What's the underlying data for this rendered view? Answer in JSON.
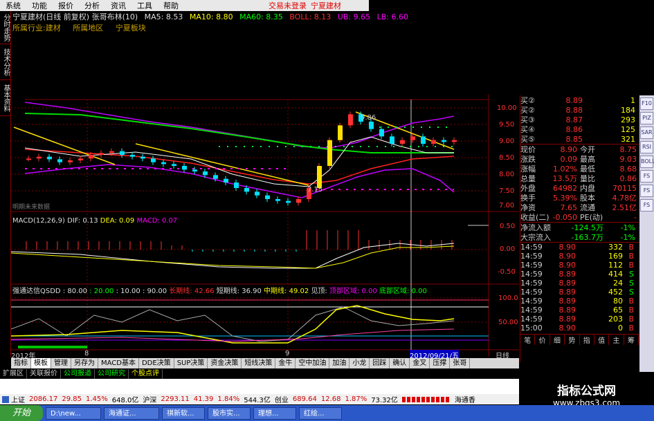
{
  "menu": {
    "items": [
      "系统",
      "功能",
      "报价",
      "分析",
      "资讯",
      "工具",
      "帮助"
    ],
    "status": "交易未登录",
    "stock_name": "宁夏建材"
  },
  "left_tabs": [
    "分时走势",
    "技术分析",
    "基本资料"
  ],
  "chart_header": {
    "title": "宁夏建材(日线 前复权) 张哥布林(10)",
    "ma5": "MA5: 8.53",
    "ma10": "MA10: 8.80",
    "ma60": "MA60: 8.35",
    "boll": "BOLL: 8.13",
    "ub": "UB: 9.65",
    "lb": "LB: 6.60",
    "industry": "所属行业:建材",
    "region": "所属地区",
    "board": "宁夏板块"
  },
  "price_axis": [
    "10.00",
    "9.50",
    "9.00",
    "8.50",
    "8.00",
    "7.50",
    "7.00"
  ],
  "chart_labels": {
    "peak": "9.86",
    "low": "7.15",
    "note": "明期未来数据"
  },
  "macd": {
    "label": "MACD(12,26,9)",
    "dif": "DIF: 0.13",
    "dea": "DEA: 0.09",
    "macd": "MACD: 0.07",
    "axis": [
      "0.50",
      "0.00",
      "-0.50"
    ]
  },
  "qsdd": {
    "label": "强通达信QSDD",
    "v1": ": 80.00",
    "v2": ": 20.00",
    "v3": ": 10.00",
    "v4": ": 90.00",
    "long": "长期线: 42.66",
    "short": "短期线: 36.90",
    "mid": "中期线: 49.02",
    "see": "见顶:",
    "top_zone": "顶部区域: 0.00",
    "bottom_zone": "底部区域: 0.00",
    "axis": [
      "100.0",
      "50.00"
    ]
  },
  "dates": {
    "year": "2012年",
    "m1": "8",
    "m2": "9",
    "current": "2012/09/21/五",
    "mode": "日线"
  },
  "order_book": [
    {
      "label": "买②",
      "price": "8.89",
      "vol": "1"
    },
    {
      "label": "买②",
      "price": "8.88",
      "vol": "184"
    },
    {
      "label": "买③",
      "price": "8.87",
      "vol": "293"
    },
    {
      "label": "买④",
      "price": "8.86",
      "vol": "125"
    },
    {
      "label": "买⑤",
      "price": "8.85",
      "vol": "321"
    }
  ],
  "quote": [
    {
      "k1": "现价",
      "v1": "8.90",
      "k2": "今开",
      "v2": "8.75"
    },
    {
      "k1": "涨跌",
      "v1": "0.09",
      "k2": "最高",
      "v2": "9.03"
    },
    {
      "k1": "涨幅",
      "v1": "1.02%",
      "k2": "最低",
      "v2": "8.68"
    },
    {
      "k1": "总量",
      "v1": "13.5万",
      "k2": "量比",
      "v2": "0.86"
    },
    {
      "k1": "外盘",
      "v1": "64982",
      "k2": "内盘",
      "v2": "70115"
    },
    {
      "k1": "换手",
      "v1": "5.39%",
      "k2": "股本",
      "v2": "4.78亿"
    },
    {
      "k1": "净资",
      "v1": "7.65",
      "k2": "流通",
      "v2": "2.51亿"
    },
    {
      "k1": "收益(二)",
      "v1": "-0.050",
      "k2": "PE(动)",
      "v2": "-"
    }
  ],
  "flow": [
    {
      "k": "净流入额",
      "v": "-124.5万",
      "p": "-1%"
    },
    {
      "k": "大宗流入",
      "v": "-163.7万",
      "p": "-1%"
    }
  ],
  "ticks": [
    {
      "t": "14:59",
      "p": "8.90",
      "v": "332",
      "s": "B"
    },
    {
      "t": "14:59",
      "p": "8.90",
      "v": "169",
      "s": "B"
    },
    {
      "t": "14:59",
      "p": "8.90",
      "v": "112",
      "s": "B"
    },
    {
      "t": "14:59",
      "p": "8.89",
      "v": "414",
      "s": "S"
    },
    {
      "t": "14:59",
      "p": "8.89",
      "v": "24",
      "s": "S"
    },
    {
      "t": "14:59",
      "p": "8.89",
      "v": "452",
      "s": "S"
    },
    {
      "t": "14:59",
      "p": "8.89",
      "v": "80",
      "s": "B"
    },
    {
      "t": "14:59",
      "p": "8.89",
      "v": "65",
      "s": "B"
    },
    {
      "t": "14:59",
      "p": "8.89",
      "v": "203",
      "s": "B"
    },
    {
      "t": "15:00",
      "p": "8.90",
      "v": "0",
      "s": "B"
    }
  ],
  "right_tabs": [
    "笔",
    "价",
    "细",
    "势",
    "指",
    "值",
    "主",
    "筹"
  ],
  "side_tools": [
    "F10",
    "PIZ",
    "SAR",
    "RSI",
    "BOLL",
    "FS",
    "FS",
    "FS"
  ],
  "bottom_tabs": [
    "指标",
    "模板",
    "管理",
    "另存为",
    "MACD基本",
    "DDE决策",
    "SUP决策",
    "资金决策",
    "短线决策",
    "金牛",
    "空中加油",
    "加油",
    "小龙",
    "回踩",
    "确认",
    "金叉",
    "压撑",
    "张哥"
  ],
  "bottom_tabs2": [
    "扩展区",
    "关联报价",
    "公司报道",
    "公司研究",
    "个股点评"
  ],
  "indexbar": {
    "sh": "上证",
    "sh_val": "2086.17",
    "sh_chg": "29.85",
    "sh_pct": "1.45%",
    "sh_amt": "648.0亿",
    "sz": "沪深",
    "sz_val": "2293.11",
    "sz_chg": "41.39",
    "sz_pct": "1.84%",
    "sz_amt": "544.3亿",
    "cy": "创业",
    "cy_val": "689.64",
    "cy_chg": "12.68",
    "cy_pct": "1.87%",
    "cy_amt": "73.32亿",
    "broker": "海通香"
  },
  "taskbar": {
    "start": "开始",
    "tasks": [
      "D:\\new...",
      "海通证...",
      "祺新软...",
      "股市实...",
      "理想...",
      "红绘..."
    ]
  },
  "watermark": {
    "title": "指标公式网",
    "url": "www.zbgs3.com"
  },
  "colors": {
    "red": "#ff3030",
    "green": "#00e060",
    "yellow": "#ffff00",
    "magenta": "#ff00ff",
    "cyan": "#00e0ff",
    "white": "#ffffff",
    "grid": "#800000"
  },
  "chart_data": {
    "type": "line",
    "note": "K-line candles approximated",
    "close_prices": [
      8.4,
      8.45,
      8.38,
      8.3,
      8.35,
      8.4,
      8.5,
      8.55,
      8.6,
      8.5,
      8.45,
      8.4,
      8.3,
      8.25,
      8.2,
      8.1,
      8.05,
      7.95,
      7.85,
      7.75,
      7.6,
      7.5,
      7.4,
      7.3,
      7.25,
      7.2,
      7.3,
      7.6,
      8.2,
      8.9,
      9.3,
      9.6,
      9.4,
      9.2,
      9.0,
      8.8,
      8.9,
      9.0,
      8.8,
      8.9,
      8.85,
      8.9
    ],
    "ylim": [
      7.0,
      10.0
    ]
  }
}
